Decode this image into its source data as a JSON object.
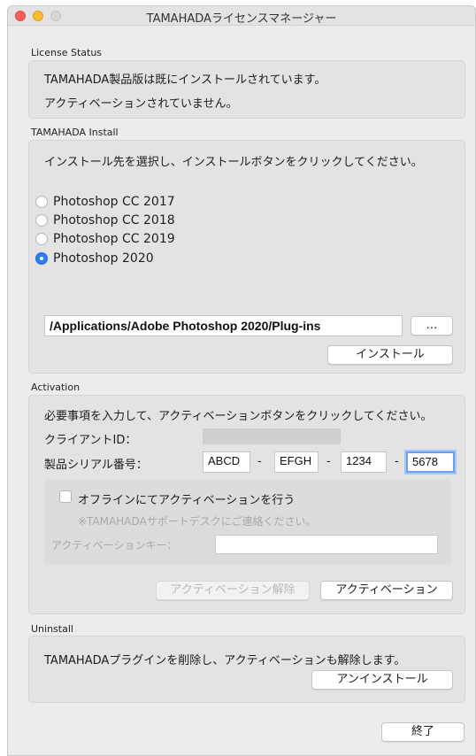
{
  "window": {
    "title": "TAMAHADAライセンスマネージャー"
  },
  "license_status": {
    "label": "License Status",
    "line1": "TAMAHADA製品版は既にインストールされています。",
    "line2": "アクティベーションされていません。"
  },
  "install": {
    "label": "TAMAHADA Install",
    "instruction": "インストール先を選択し、インストールボタンをクリックしてください。",
    "options": [
      {
        "label": "Photoshop CC 2017",
        "selected": false
      },
      {
        "label": "Photoshop CC 2018",
        "selected": false
      },
      {
        "label": "Photoshop CC 2019",
        "selected": false
      },
      {
        "label": "Photoshop 2020",
        "selected": true
      }
    ],
    "path": "/Applications/Adobe Photoshop 2020/Plug-ins",
    "browse_label": "...",
    "install_button": "インストール"
  },
  "activation": {
    "label": "Activation",
    "instruction": "必要事項を入力して、アクティベーションボタンをクリックしてください。",
    "client_id_label": "クライアントID：",
    "serial_label": "製品シリアル番号：",
    "serial_parts": [
      "ABCD",
      "EFGH",
      "1234",
      "5678"
    ],
    "separator": "-",
    "offline_label": "オフラインにてアクティベーションを行う",
    "offline_note": "※TAMAHADAサポートデスクにご連絡ください。",
    "key_label": "アクティベーションキー：",
    "deactivate_button": "アクティベーション解除",
    "activate_button": "アクティベーション"
  },
  "uninstall": {
    "label": "Uninstall",
    "instruction": "TAMAHADAプラグインを削除し、アクティベーションも解除します。",
    "button": "アンインストール"
  },
  "footer": {
    "quit_button": "終了"
  }
}
